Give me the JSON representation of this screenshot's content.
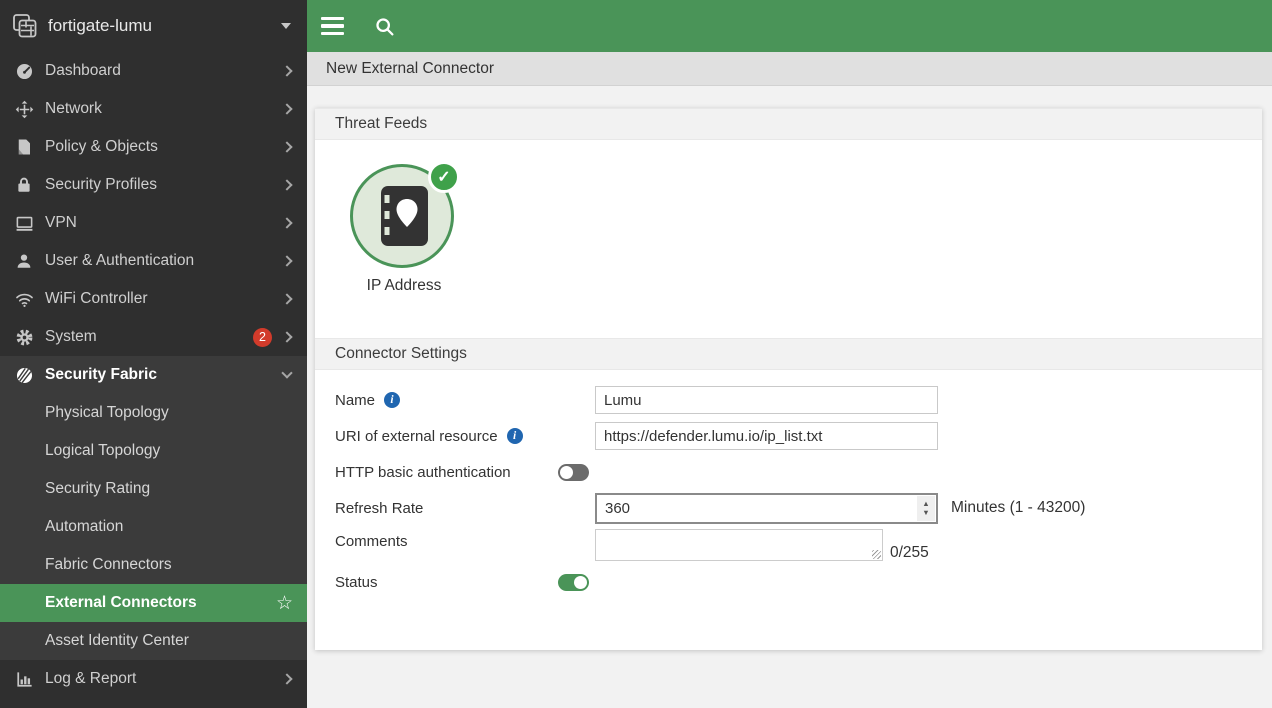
{
  "sidebar": {
    "hostname": "fortigate-lumu",
    "items": [
      {
        "label": "Dashboard",
        "icon": "gauge-icon"
      },
      {
        "label": "Network",
        "icon": "arrows-move-icon"
      },
      {
        "label": "Policy & Objects",
        "icon": "document-icon"
      },
      {
        "label": "Security Profiles",
        "icon": "lock-icon"
      },
      {
        "label": "VPN",
        "icon": "monitor-icon"
      },
      {
        "label": "User & Authentication",
        "icon": "user-icon"
      },
      {
        "label": "WiFi Controller",
        "icon": "wifi-icon"
      },
      {
        "label": "System",
        "icon": "gear-icon",
        "badge": "2"
      },
      {
        "label": "Security Fabric",
        "icon": "fabric-icon",
        "expanded": true,
        "children": [
          {
            "label": "Physical Topology"
          },
          {
            "label": "Logical Topology"
          },
          {
            "label": "Security Rating"
          },
          {
            "label": "Automation"
          },
          {
            "label": "Fabric Connectors"
          },
          {
            "label": "External Connectors",
            "selected": true,
            "starred": true
          },
          {
            "label": "Asset Identity Center"
          }
        ]
      },
      {
        "label": "Log & Report",
        "icon": "bar-chart-icon"
      }
    ]
  },
  "topbar": {
    "menu_icon": "hamburger-icon",
    "search_icon": "search-icon"
  },
  "breadcrumb": {
    "title": "New External Connector"
  },
  "page": {
    "threat_feeds": {
      "title": "Threat Feeds",
      "tile": {
        "label": "IP Address",
        "checked": true,
        "icon": "address-book-pin-icon"
      }
    },
    "connector_settings": {
      "title": "Connector Settings",
      "name": {
        "label": "Name",
        "value": "Lumu"
      },
      "uri": {
        "label": "URI of external resource",
        "value": "https://defender.lumu.io/ip_list.txt"
      },
      "http_auth": {
        "label": "HTTP basic authentication",
        "enabled": false
      },
      "refresh_rate": {
        "label": "Refresh Rate",
        "value": "360",
        "unit": "Minutes (1 - 43200)"
      },
      "comments": {
        "label": "Comments",
        "value": "",
        "counter": "0/255"
      },
      "status": {
        "label": "Status",
        "enabled": true
      }
    }
  },
  "colors": {
    "brand_green": "#4a9458",
    "sidebar_bg": "#2f2f2f",
    "sidebar_open_section_bg": "#3b3b3b",
    "badge_red": "#d23b2b",
    "info_blue": "#2066b0",
    "check_green": "#3fa14a",
    "tile_fill": "#dfe9da"
  }
}
